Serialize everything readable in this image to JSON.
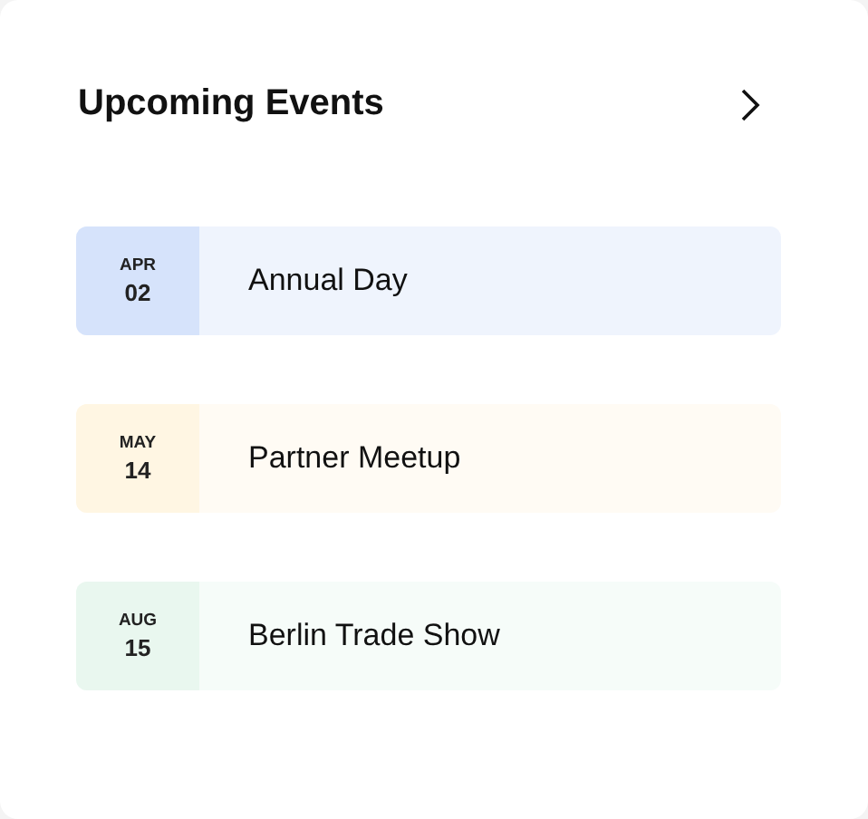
{
  "header": {
    "title": "Upcoming Events"
  },
  "events": [
    {
      "month": "APR",
      "day": "02",
      "name": "Annual Day",
      "color": "#d6e3fb"
    },
    {
      "month": "MAY",
      "day": "14",
      "name": "Partner Meetup",
      "color": "#fff6e3"
    },
    {
      "month": "AUG",
      "day": "15",
      "name": "Berlin Trade Show",
      "color": "#e9f7ef"
    }
  ]
}
